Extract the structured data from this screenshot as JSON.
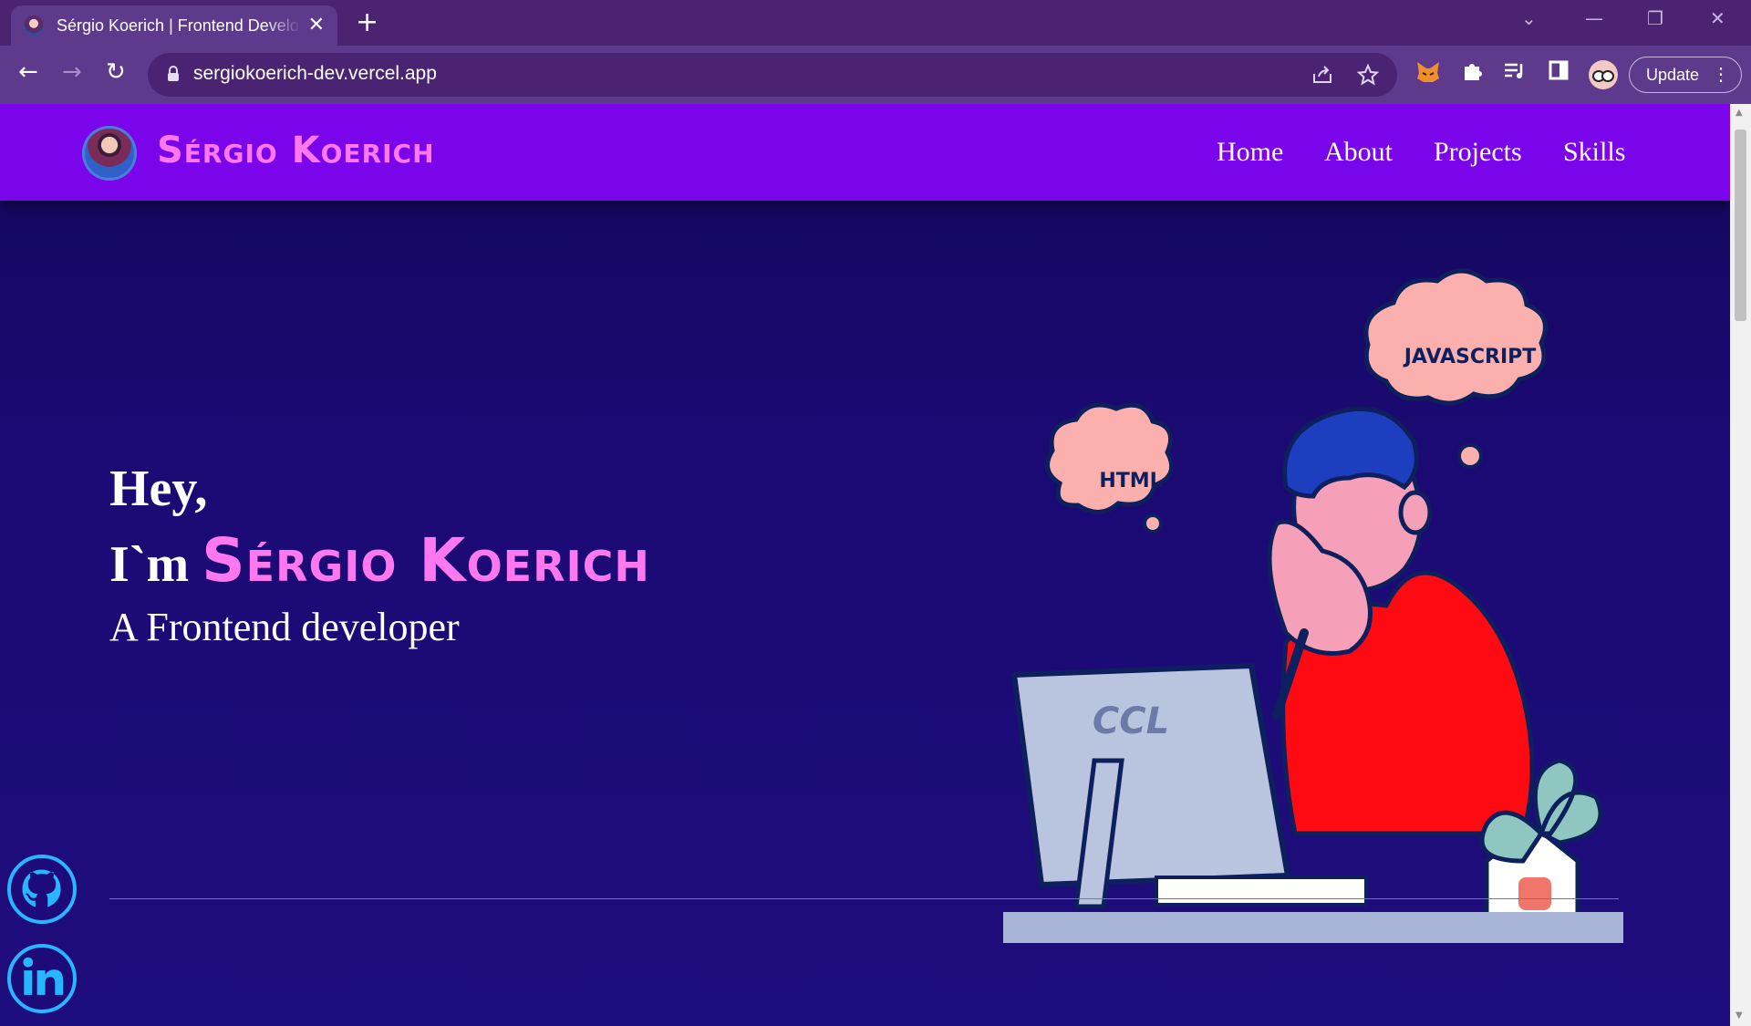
{
  "browser": {
    "tab_title": "Sérgio Koerich | Frontend Developer",
    "tab_close": "✕",
    "new_tab": "+",
    "url": "sergiokoerich-dev.vercel.app",
    "update_label": "Update",
    "back": "←",
    "forward": "→",
    "reload": "↻",
    "menu_dots": "⋮",
    "window_controls": {
      "search": "⌄",
      "minimize": "—",
      "restore": "❐",
      "close": "✕"
    }
  },
  "site": {
    "brand": "Sérgio Koerich",
    "nav": [
      "Home",
      "About",
      "Projects",
      "Skills"
    ]
  },
  "hero": {
    "greeting": "Hey,",
    "im": "I`m",
    "name": "Sérgio Koerich",
    "role": "A Frontend developer"
  },
  "illustration": {
    "bubbles": [
      "HTML",
      "JAVASCRIPT"
    ],
    "monitor_logo": "CCL"
  },
  "colors": {
    "header": "#7b05ea",
    "brand_pink": "#ff78f0",
    "background": "#1a0970",
    "social_blue": "#27b6ff"
  }
}
